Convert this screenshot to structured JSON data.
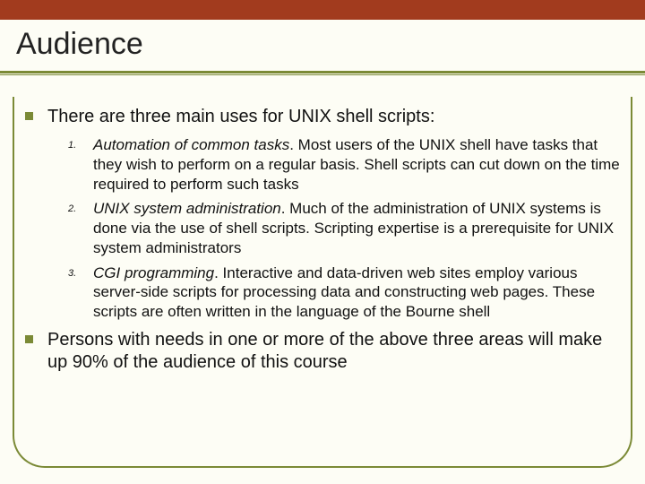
{
  "title": "Audience",
  "bullets": {
    "intro": "There are three main uses for UNIX shell scripts:",
    "items": [
      {
        "num": "1.",
        "lead": "Automation of common tasks",
        "rest": ".  Most users of the UNIX shell have tasks that they wish to perform on a regular basis.  Shell scripts can cut down on the time required to perform such tasks"
      },
      {
        "num": "2.",
        "lead": "UNIX system administration",
        "rest": ".  Much of the administration of UNIX systems is done via the use of shell scripts.  Scripting expertise is a prerequisite for UNIX system administrators"
      },
      {
        "num": "3.",
        "lead": "CGI programming",
        "rest": ".  Interactive and data-driven web sites employ various server-side scripts for processing data and constructing web pages.  These scripts are often written in the language of the Bourne shell"
      }
    ],
    "closing": "Persons with needs in one or more of the above three areas will make up 90% of the audience of this course"
  }
}
